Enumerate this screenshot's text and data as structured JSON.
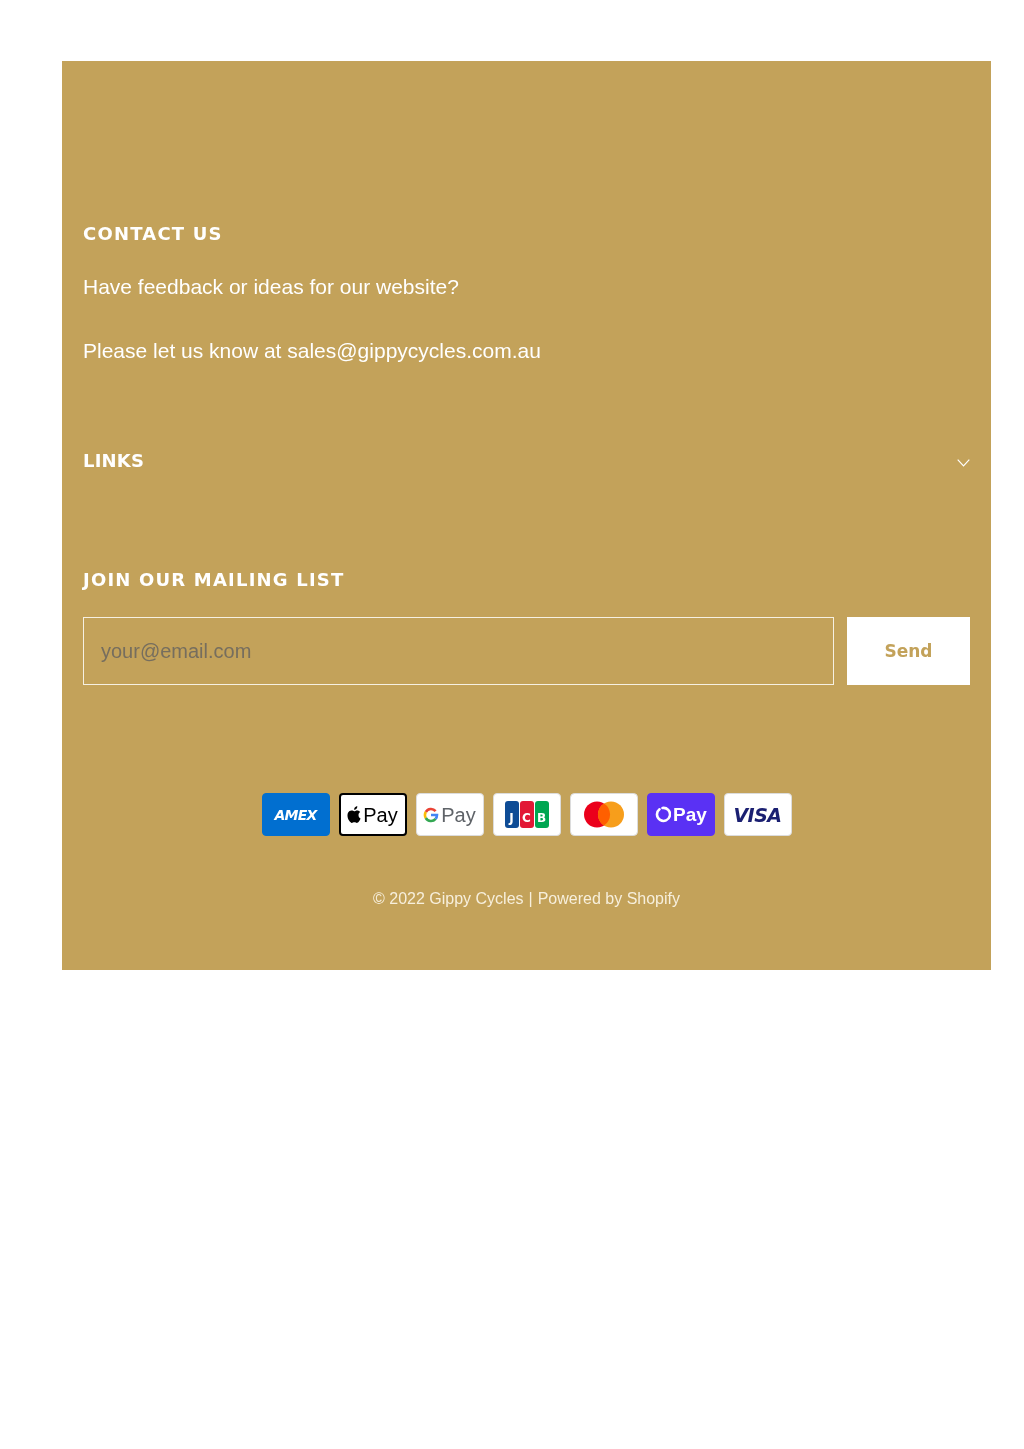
{
  "contact": {
    "heading": "CONTACT US",
    "paragraphs": [
      "Have feedback or ideas for our website?",
      "Please let us know at sales@gippycycles.com.au"
    ]
  },
  "links": {
    "heading": "LINKS",
    "expanded": false
  },
  "mailing_list": {
    "heading": "JOIN OUR MAILING LIST",
    "email_field": {
      "placeholder": "your@email.com"
    },
    "button": "Send"
  },
  "payment_icons": [
    {
      "kind": "amex",
      "label": "AMEX"
    },
    {
      "kind": "apple_pay",
      "label": "Pay"
    },
    {
      "kind": "google_pay",
      "label": "Pay"
    },
    {
      "kind": "jcb",
      "letters": [
        "J",
        "C",
        "B"
      ]
    },
    {
      "kind": "mastercard"
    },
    {
      "kind": "shop_pay",
      "label": "Pay"
    },
    {
      "kind": "visa",
      "label": "VISA"
    }
  ],
  "copyright": {
    "text": "© 2022 Gippy Cycles",
    "separator": "|",
    "powered_by": "Powered by Shopify"
  }
}
